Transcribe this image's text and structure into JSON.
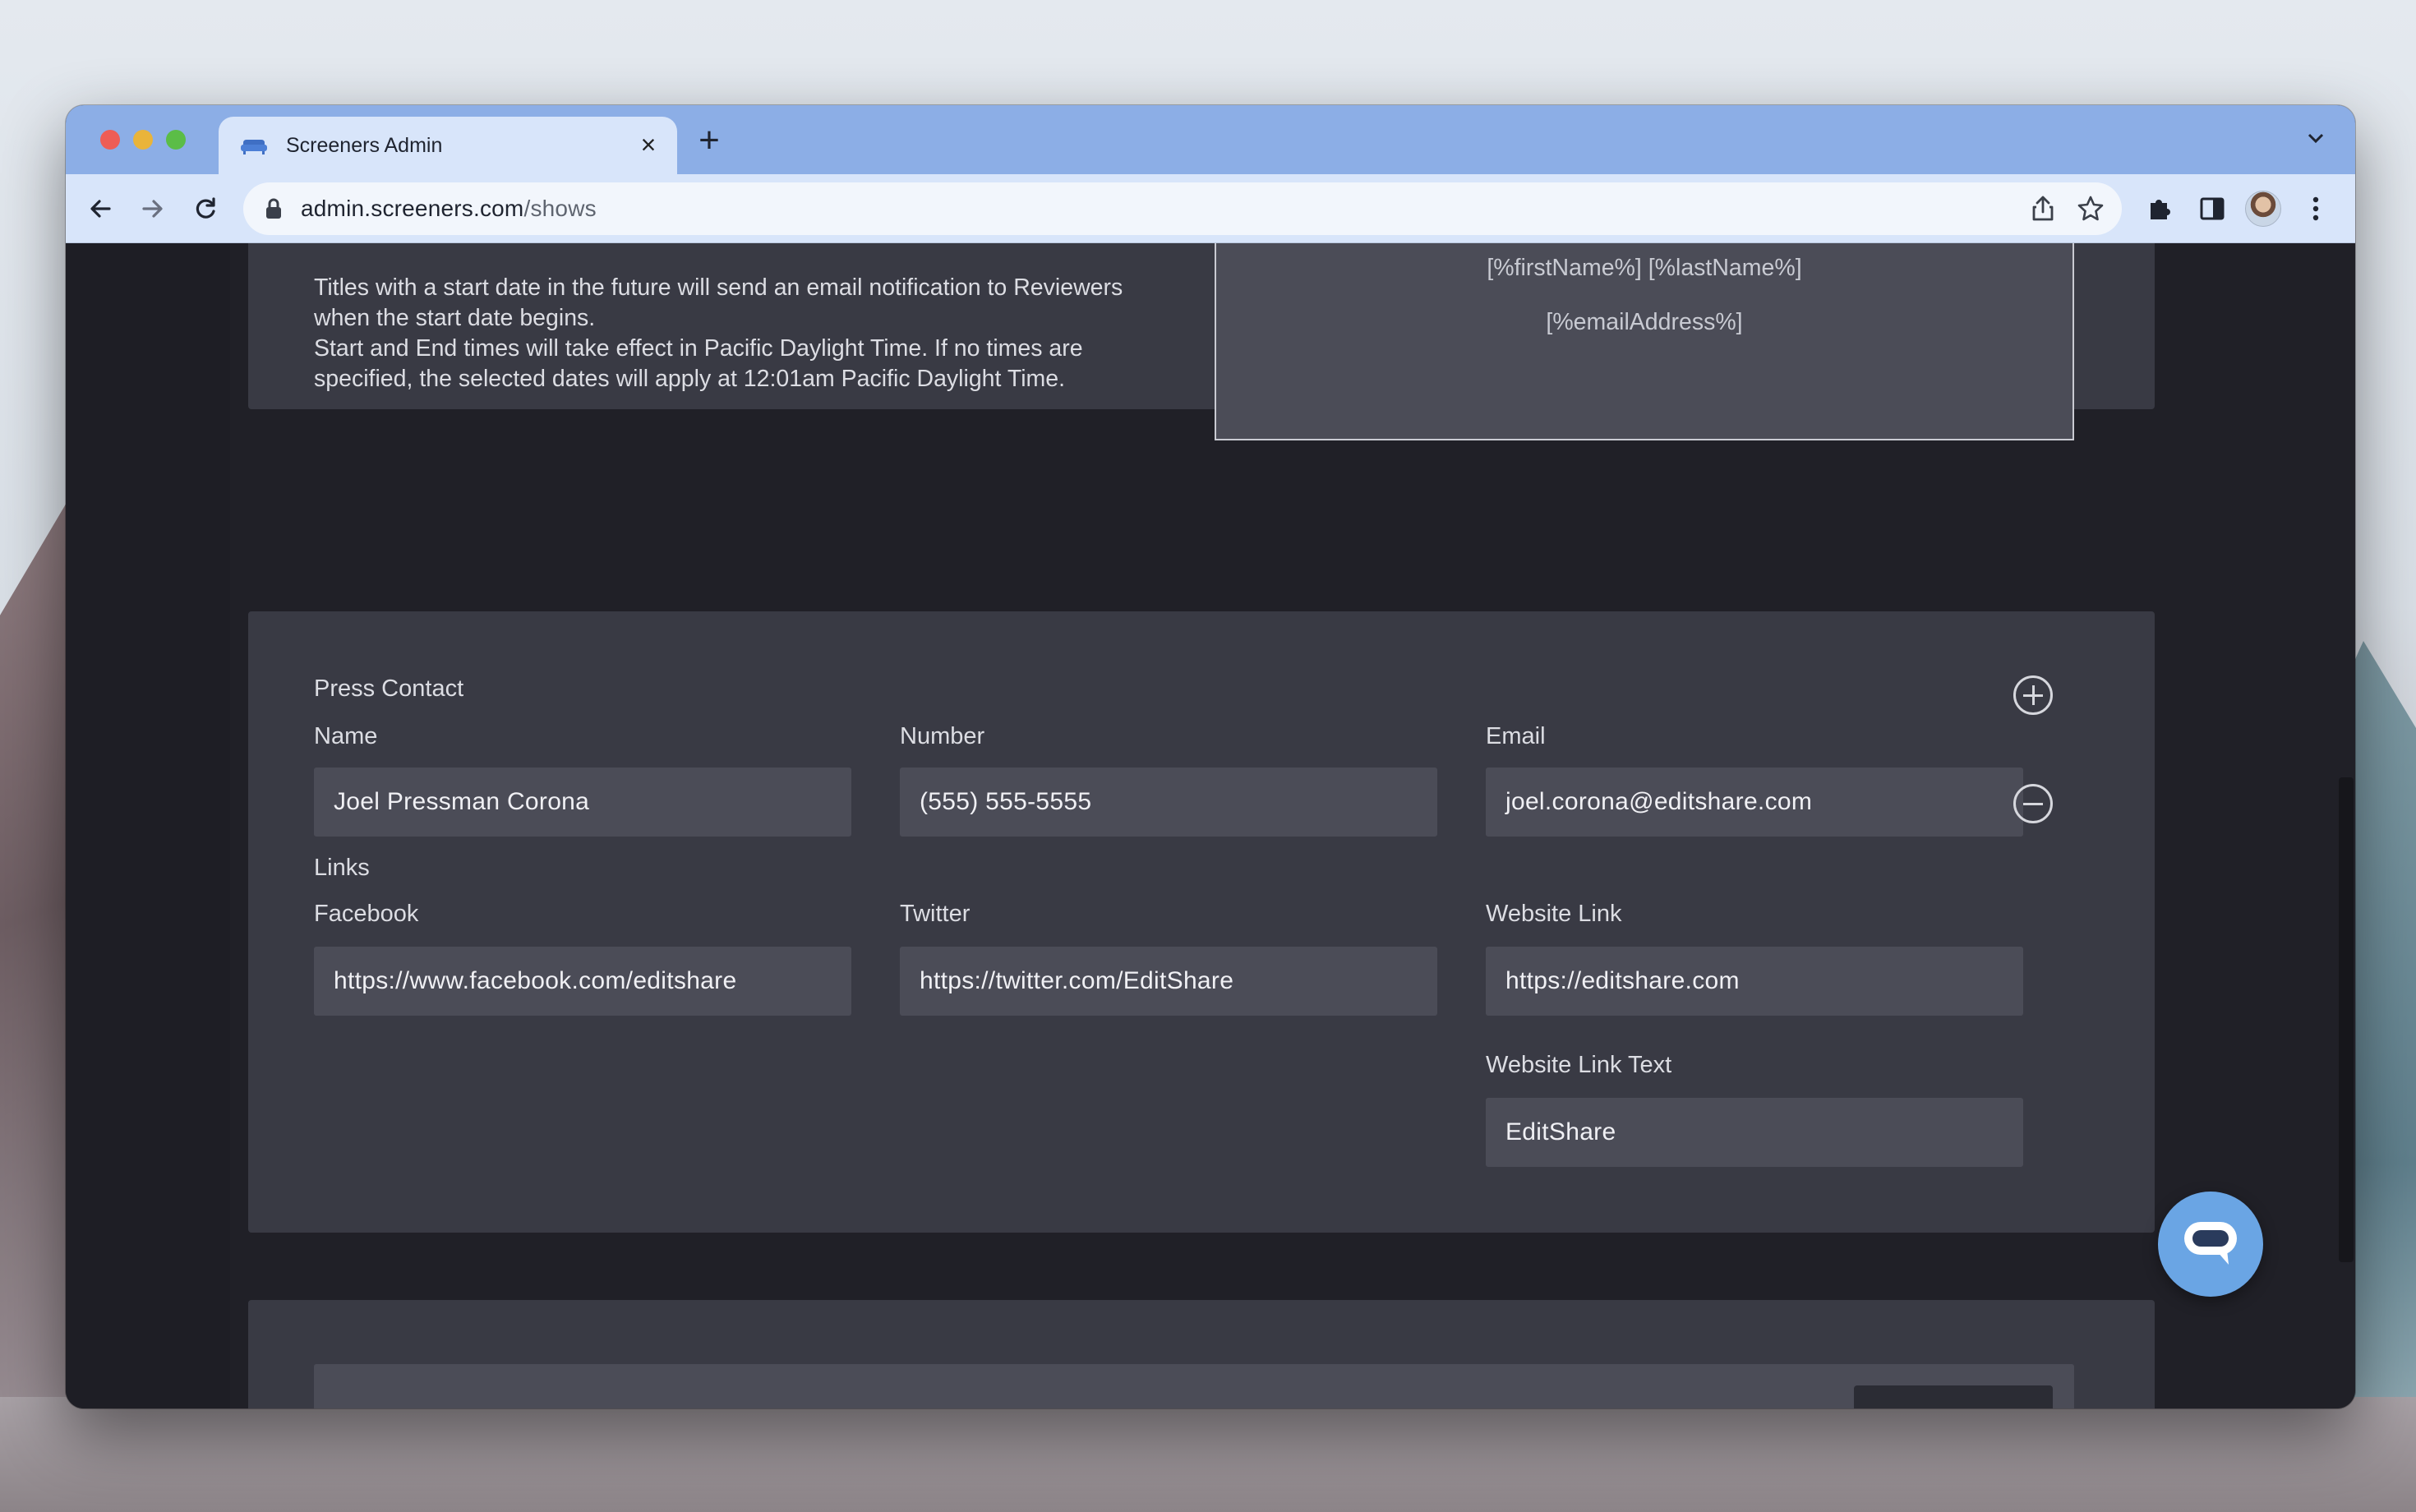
{
  "browser": {
    "tab_title": "Screeners Admin",
    "url_host": "admin.screeners.com",
    "url_path": "/shows"
  },
  "schedule": {
    "info_future": "Titles with a start date in the future will send an email notification to Reviewers when the start date begins.",
    "info_times": "Start and End times will take effect in Pacific Daylight Time. If no times are specified, the selected dates will apply at 12:01am Pacific Daylight Time."
  },
  "watermark_preview": {
    "name_line": "[%firstName%] [%lastName%]",
    "email_line": "[%emailAddress%]"
  },
  "press_contact": {
    "section_title": "Press Contact",
    "name_label": "Name",
    "name_value": "Joel Pressman Corona",
    "number_label": "Number",
    "number_value": "(555) 555-5555",
    "email_label": "Email",
    "email_value": "joel.corona@editshare.com"
  },
  "links": {
    "section_title": "Links",
    "facebook_label": "Facebook",
    "facebook_value": "https://www.facebook.com/editshare",
    "twitter_label": "Twitter",
    "twitter_value": "https://twitter.com/EditShare",
    "website_label": "Website Link",
    "website_value": "https://editshare.com",
    "website_text_label": "Website Link Text",
    "website_text_value": "EditShare"
  },
  "icons": {
    "add": "plus-circle-icon",
    "remove": "minus-circle-icon",
    "chat": "chat-bubble-icon"
  },
  "colors": {
    "tabstrip": "#8caee6",
    "toolbar": "#d8e5fa",
    "page_bg": "#202027",
    "panel": "#393a44",
    "field": "#4b4c57",
    "chat_accent": "#6aa5e4"
  }
}
